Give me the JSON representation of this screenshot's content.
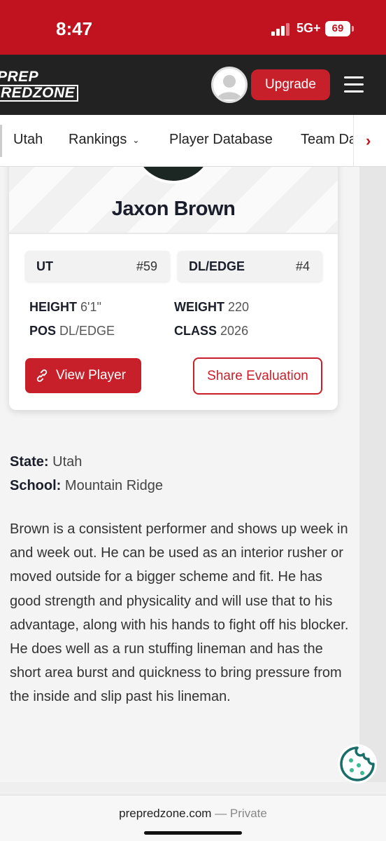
{
  "status_bar": {
    "time": "8:47",
    "network": "5G+",
    "battery": "69"
  },
  "header": {
    "logo_line1": "PREP",
    "logo_line2": "REDZONE",
    "upgrade_label": "Upgrade"
  },
  "nav": {
    "items": [
      "Utah",
      "Rankings",
      "Player Database",
      "Team Da"
    ],
    "chevron": "⌄",
    "more_arrow": "›"
  },
  "player": {
    "name": "Jaxon Brown",
    "state_pill": {
      "label": "UT",
      "rank": "#59"
    },
    "position_pill": {
      "label": "DL/EDGE",
      "rank": "#4"
    },
    "height_label": "HEIGHT",
    "height_value": "6'1\"",
    "weight_label": "WEIGHT",
    "weight_value": "220",
    "pos_label": "POS",
    "pos_value": "DL/EDGE",
    "class_label": "CLASS",
    "class_value": "2026",
    "view_button": "View Player",
    "share_button": "Share Evaluation"
  },
  "details": {
    "state_label": "State:",
    "state_value": "Utah",
    "school_label": "School:",
    "school_value": "Mountain Ridge",
    "evaluation": "Brown is a consistent performer and shows up week in and week out. He can be used as an interior rusher or moved outside for a bigger scheme and fit. He has good strength and physicality and will use that to his advantage, along with his hands to fight off his blocker. He does well as a run stuffing lineman and has the short area burst and quickness to bring pressure from the inside and slip past his lineman."
  },
  "browser": {
    "domain": "prepredzone.com",
    "mode": " — Private"
  },
  "colors": {
    "brand_red": "#c8202a",
    "header_dark": "#222222",
    "cookie_teal": "#1a6e6a"
  }
}
